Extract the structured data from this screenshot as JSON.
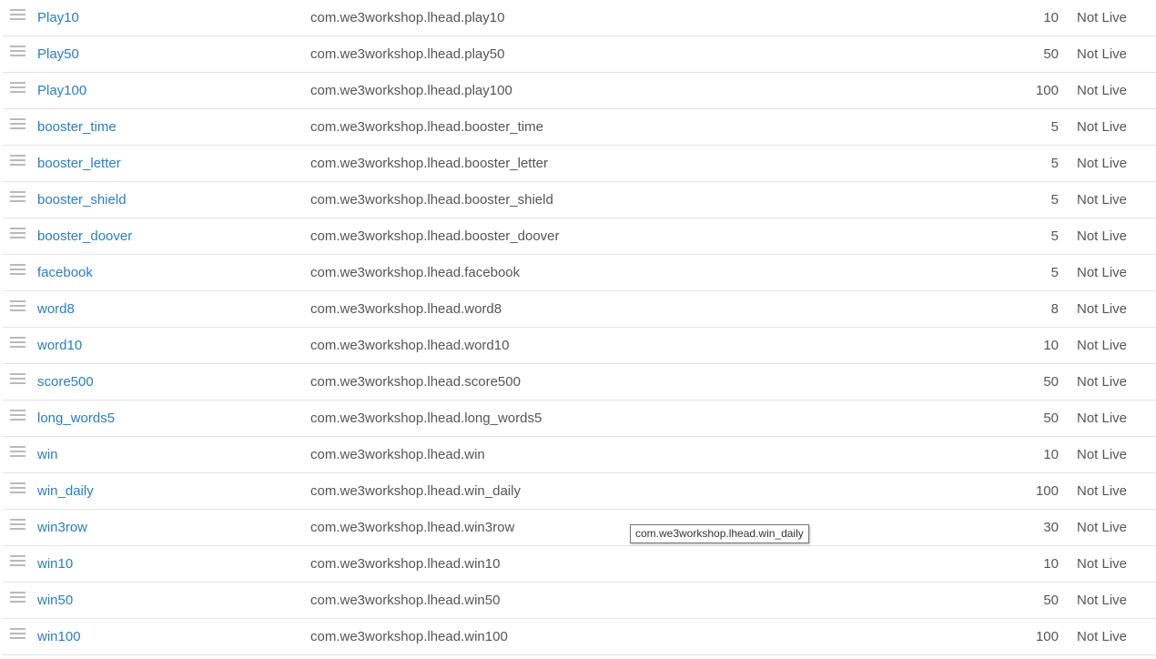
{
  "rows": [
    {
      "name": "Play10",
      "product_id": "com.we3workshop.lhead.play10",
      "points": "10",
      "status": "Not Live"
    },
    {
      "name": "Play50",
      "product_id": "com.we3workshop.lhead.play50",
      "points": "50",
      "status": "Not Live"
    },
    {
      "name": "Play100",
      "product_id": "com.we3workshop.lhead.play100",
      "points": "100",
      "status": "Not Live"
    },
    {
      "name": "booster_time",
      "product_id": "com.we3workshop.lhead.booster_time",
      "points": "5",
      "status": "Not Live"
    },
    {
      "name": "booster_letter",
      "product_id": "com.we3workshop.lhead.booster_letter",
      "points": "5",
      "status": "Not Live"
    },
    {
      "name": "booster_shield",
      "product_id": "com.we3workshop.lhead.booster_shield",
      "points": "5",
      "status": "Not Live"
    },
    {
      "name": "booster_doover",
      "product_id": "com.we3workshop.lhead.booster_doover",
      "points": "5",
      "status": "Not Live"
    },
    {
      "name": "facebook",
      "product_id": "com.we3workshop.lhead.facebook",
      "points": "5",
      "status": "Not Live"
    },
    {
      "name": "word8",
      "product_id": "com.we3workshop.lhead.word8",
      "points": "8",
      "status": "Not Live"
    },
    {
      "name": "word10",
      "product_id": "com.we3workshop.lhead.word10",
      "points": "10",
      "status": "Not Live"
    },
    {
      "name": "score500",
      "product_id": "com.we3workshop.lhead.score500",
      "points": "50",
      "status": "Not Live"
    },
    {
      "name": "long_words5",
      "product_id": "com.we3workshop.lhead.long_words5",
      "points": "50",
      "status": "Not Live"
    },
    {
      "name": "win",
      "product_id": "com.we3workshop.lhead.win",
      "points": "10",
      "status": "Not Live"
    },
    {
      "name": "win_daily",
      "product_id": "com.we3workshop.lhead.win_daily",
      "points": "100",
      "status": "Not Live"
    },
    {
      "name": "win3row",
      "product_id": "com.we3workshop.lhead.win3row",
      "points": "30",
      "status": "Not Live"
    },
    {
      "name": "win10",
      "product_id": "com.we3workshop.lhead.win10",
      "points": "10",
      "status": "Not Live"
    },
    {
      "name": "win50",
      "product_id": "com.we3workshop.lhead.win50",
      "points": "50",
      "status": "Not Live"
    },
    {
      "name": "win100",
      "product_id": "com.we3workshop.lhead.win100",
      "points": "100",
      "status": "Not Live"
    }
  ],
  "tooltip": {
    "text": "com.we3workshop.lhead.win_daily"
  },
  "icons": {
    "drag_handle": "drag-handle-icon"
  },
  "colors": {
    "link": "#2a7cc7",
    "text": "#555555",
    "divider": "#e3e3e3"
  }
}
